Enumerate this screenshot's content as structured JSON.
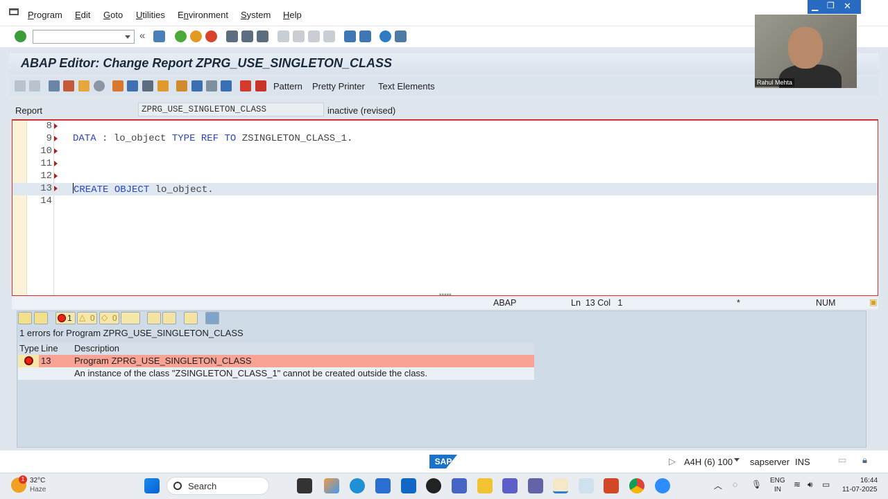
{
  "menu": {
    "items": [
      "Program",
      "Edit",
      "Goto",
      "Utilities",
      "Environment",
      "System",
      "Help"
    ],
    "underline": [
      "P",
      "E",
      "G",
      "U",
      "n",
      "S",
      "H"
    ]
  },
  "title": "ABAP Editor: Change Report ZPRG_USE_SINGLETON_CLASS",
  "app_toolbar": {
    "pattern": "Pattern",
    "pretty_printer": "Pretty Printer",
    "text_elements": "Text Elements"
  },
  "report": {
    "label": "Report",
    "value": "ZPRG_USE_SINGLETON_CLASS",
    "status": "inactive (revised)"
  },
  "editor": {
    "lines": [
      {
        "no": "8",
        "text": ""
      },
      {
        "no": "9",
        "text": "DATA : lo_object TYPE REF TO ZSINGLETON_CLASS_1."
      },
      {
        "no": "10",
        "text": ""
      },
      {
        "no": "11",
        "text": ""
      },
      {
        "no": "12",
        "text": ""
      },
      {
        "no": "13",
        "text": "CREATE OBJECT lo_object."
      },
      {
        "no": "14",
        "text": ""
      }
    ]
  },
  "status_bar": {
    "lang": "ABAP",
    "position": "Ln  13 Col   1",
    "modified": "*",
    "mode": "NUM"
  },
  "errors": {
    "count_errors": "1",
    "count_warnings": "0",
    "count_info": "0",
    "summary": "1 errors for Program ZPRG_USE_SINGLETON_CLASS",
    "headers": {
      "type": "Type",
      "line": "Line",
      "description": "Description"
    },
    "rows": [
      {
        "line": "13",
        "description": "Program ZPRG_USE_SINGLETON_CLASS"
      },
      {
        "line": "",
        "description": "An instance of the class \"ZSINGLETON_CLASS_1\" cannot be created outside the class."
      }
    ]
  },
  "sap_status": {
    "logo": "SAP",
    "system": "A4H (6) 100",
    "server": "sapserver",
    "ins": "INS"
  },
  "webcam": {
    "name": "Rahul Mehta"
  },
  "taskbar": {
    "weather_temp": "32°C",
    "weather_desc": "Haze",
    "weather_badge": "1",
    "search": "Search",
    "lang1": "ENG",
    "lang2": "IN",
    "time": "16:44",
    "date": "11-07-2025"
  },
  "colors": {
    "error_row": "#f8a394",
    "keyword": "#2a46c6",
    "title": "#1b2a3a"
  }
}
